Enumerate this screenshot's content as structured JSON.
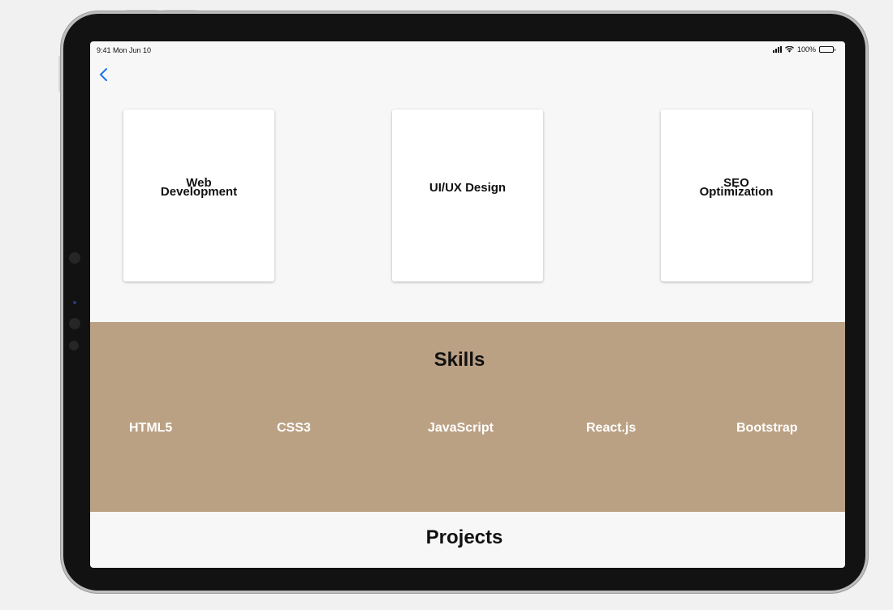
{
  "status_bar": {
    "time": "9:41  Mon Jun 10",
    "battery": "100%"
  },
  "services": [
    {
      "line1": "Web",
      "line2": "Development"
    },
    {
      "line1": "UI/UX Design",
      "line2": ""
    },
    {
      "line1": "SEO",
      "line2": "Optimization"
    }
  ],
  "skills": {
    "title": "Skills",
    "items": [
      "HTML5",
      "CSS3",
      "JavaScript",
      "React.js",
      "Bootstrap"
    ],
    "background": "#bba183"
  },
  "projects": {
    "title": "Projects"
  },
  "colors": {
    "accent": "#1a73e8",
    "screen_bg": "#f7f7f7",
    "card_bg": "#ffffff"
  }
}
